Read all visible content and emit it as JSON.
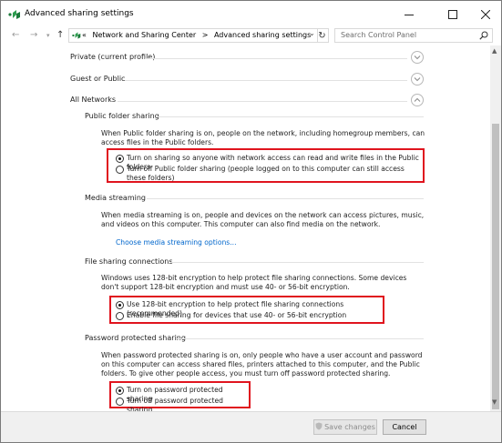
{
  "window": {
    "title": "Advanced sharing settings"
  },
  "address": {
    "prefix": "«",
    "crumbs": [
      "Network and Sharing Center",
      ">",
      "Advanced sharing settings"
    ]
  },
  "search": {
    "placeholder": "Search Control Panel"
  },
  "profiles": {
    "private": "Private (current profile)",
    "guest": "Guest or Public",
    "all": "All Networks"
  },
  "public_folder": {
    "heading": "Public folder sharing",
    "description": "When Public folder sharing is on, people on the network, including homegroup members, can access files in the Public folders.",
    "options": [
      "Turn on sharing so anyone with network access can read and write files in the Public folders",
      "Turn off Public folder sharing (people logged on to this computer can still access these folders)"
    ],
    "selected": 0
  },
  "media": {
    "heading": "Media streaming",
    "description": "When media streaming is on, people and devices on the network can access pictures, music, and videos on this computer. This computer can also find media on the network.",
    "link": "Choose media streaming options..."
  },
  "file_sharing": {
    "heading": "File sharing connections",
    "description": "Windows uses 128-bit encryption to help protect file sharing connections. Some devices don't support 128-bit encryption and must use 40- or 56-bit encryption.",
    "options": [
      "Use 128-bit encryption to help protect file sharing connections (recommended)",
      "Enable file sharing for devices that use 40- or 56-bit encryption"
    ],
    "selected": 0
  },
  "password": {
    "heading": "Password protected sharing",
    "description": "When password protected sharing is on, only people who have a user account and password on this computer can access shared files, printers attached to this computer, and the Public folders. To give other people access, you must turn off password protected sharing.",
    "options": [
      "Turn on password protected sharing",
      "Turn off password protected sharing"
    ],
    "selected": 0
  },
  "footer": {
    "save": "Save changes",
    "cancel": "Cancel"
  },
  "colors": {
    "highlight_box": "#e0141e",
    "link": "#0066cc"
  }
}
